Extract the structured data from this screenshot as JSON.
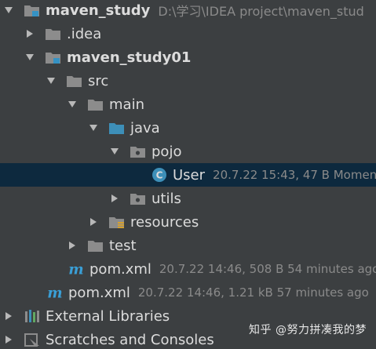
{
  "tree": [
    {
      "label": "maven_study",
      "meta": "D:\\学习\\IDEA project\\maven_stud",
      "icon": "module-folder-icon",
      "arrow": "expanded"
    },
    {
      "label": ".idea",
      "meta": "",
      "icon": "folder-icon",
      "arrow": "collapsed"
    },
    {
      "label": "maven_study01",
      "meta": "",
      "icon": "module-folder-icon",
      "arrow": "expanded"
    },
    {
      "label": "src",
      "meta": "",
      "icon": "folder-icon",
      "arrow": "expanded"
    },
    {
      "label": "main",
      "meta": "",
      "icon": "folder-icon",
      "arrow": "expanded"
    },
    {
      "label": "java",
      "meta": "",
      "icon": "source-folder-icon",
      "arrow": "expanded"
    },
    {
      "label": "pojo",
      "meta": "",
      "icon": "package-icon",
      "arrow": "expanded"
    },
    {
      "label": "User",
      "meta": "20.7.22 15:43, 47 B Momen",
      "icon": "java-class-icon",
      "arrow": "none"
    },
    {
      "label": "utils",
      "meta": "",
      "icon": "package-icon",
      "arrow": "collapsed"
    },
    {
      "label": "resources",
      "meta": "",
      "icon": "resources-folder-icon",
      "arrow": "collapsed"
    },
    {
      "label": "test",
      "meta": "",
      "icon": "folder-icon",
      "arrow": "collapsed"
    },
    {
      "label": "pom.xml",
      "meta": "20.7.22 14:46, 508 B 54 minutes ago",
      "icon": "maven-icon",
      "arrow": "none"
    },
    {
      "label": "pom.xml",
      "meta": "20.7.22 14:46, 1.21 kB 57 minutes ago",
      "icon": "maven-icon",
      "arrow": "none"
    },
    {
      "label": "External Libraries",
      "meta": "",
      "icon": "libraries-icon",
      "arrow": "collapsed"
    },
    {
      "label": "Scratches and Consoles",
      "meta": "",
      "icon": "scratches-icon",
      "arrow": "collapsed"
    }
  ],
  "watermark": "知乎 @努力拼凑我的梦",
  "colors": {
    "background": "#3c3f41",
    "selection": "#0d293e",
    "text": "#dcdcdc",
    "meta_text": "#8a8a8a",
    "folder": "#8c8c8c",
    "module_badge": "#3592c4",
    "class_icon": "#3d8fb8",
    "maven": "#3a9fd6"
  }
}
